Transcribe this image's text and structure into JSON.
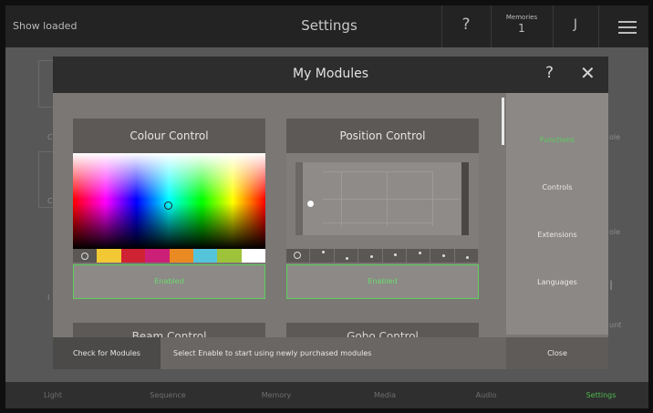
{
  "header": {
    "status": "Show loaded",
    "title": "Settings",
    "help": "?",
    "memories_label": "Memories",
    "memories_value": "1",
    "user_initial": "J"
  },
  "background": {
    "texts": [
      "C",
      "C",
      "ole",
      "ole",
      "unt",
      "I",
      "I"
    ]
  },
  "modal": {
    "title": "My Modules",
    "help": "?",
    "close_glyph": "✕",
    "panels": [
      {
        "title": "Colour Control",
        "status": "Enabled"
      },
      {
        "title": "Position Control",
        "status": "Enabled"
      }
    ],
    "next_panels": [
      "Beam Control",
      "Gobo Control"
    ],
    "colour_chips": [
      "#5a5754",
      "#f2c935",
      "#cf2233",
      "#cc1f77",
      "#ea8a23",
      "#55c4db",
      "#9fc23b",
      "#ffffff"
    ],
    "sidebar": [
      "Functions",
      "Controls",
      "Extensions",
      "Languages"
    ],
    "active_color": "#5fcf5f",
    "footer": {
      "check": "Check for Modules",
      "hint": "Select Enable to start using newly purchased modules",
      "close": "Close"
    }
  },
  "bottom_nav": [
    "Light",
    "Sequence",
    "Memory",
    "Media",
    "Audio",
    "Settings"
  ]
}
